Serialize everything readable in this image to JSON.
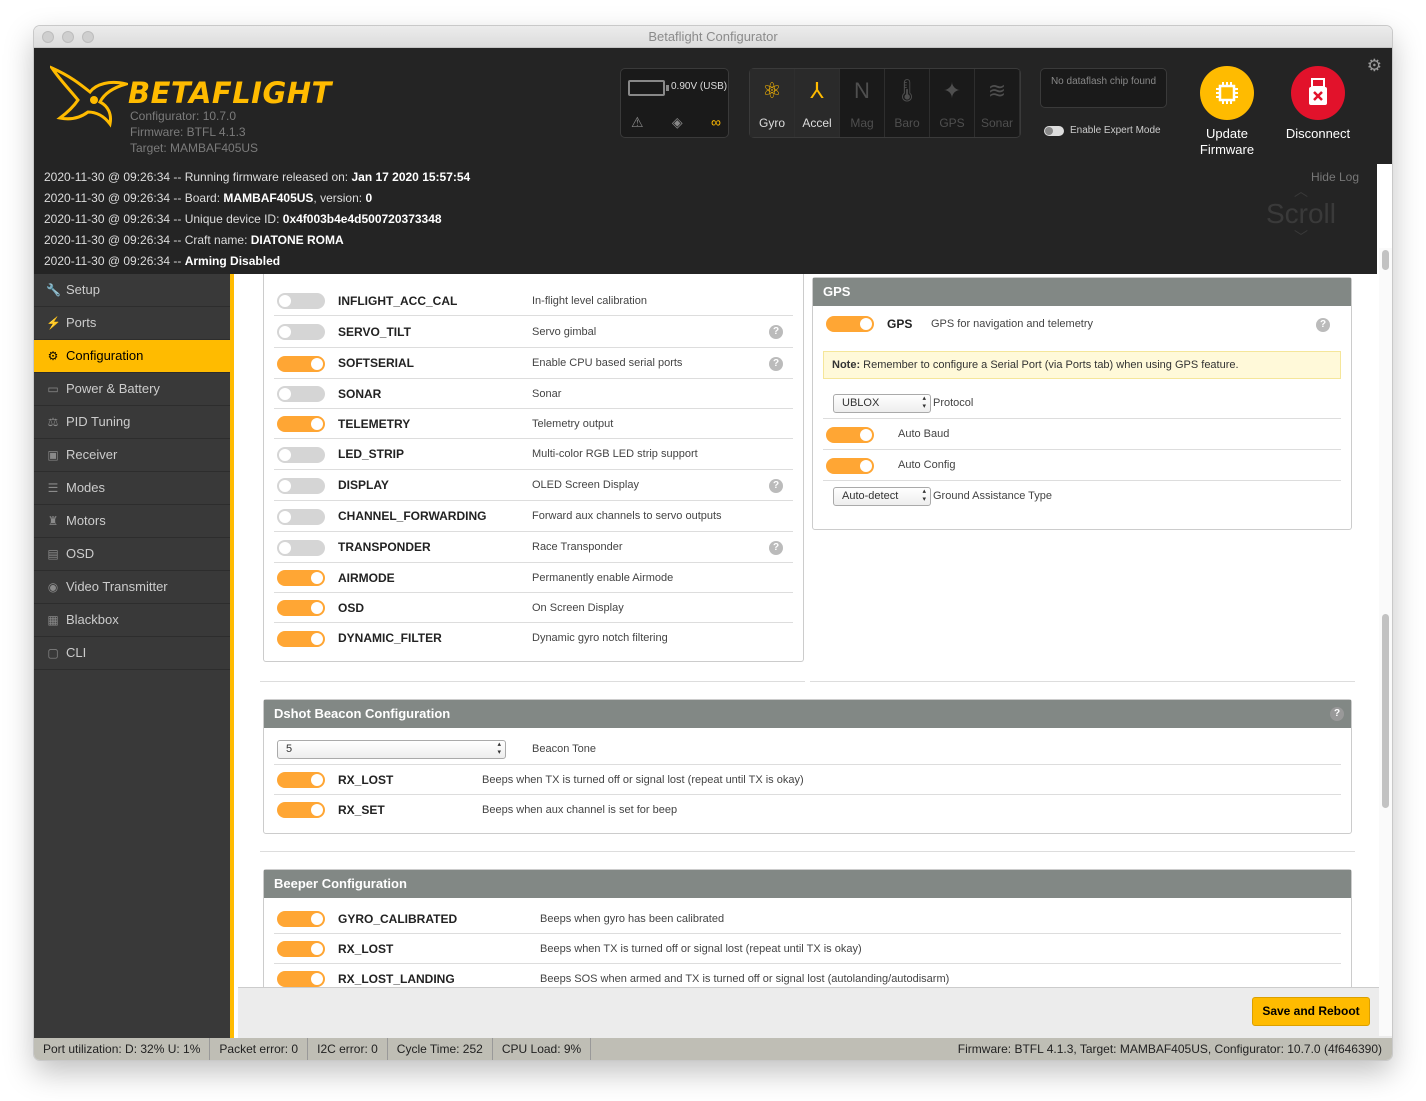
{
  "window": {
    "title": "Betaflight Configurator"
  },
  "header": {
    "brand": "BETAFLIGHT",
    "configurator": "Configurator: 10.7.0",
    "firmware": "Firmware: BTFL 4.1.3",
    "target": "Target: MAMBAF405US",
    "battery": "0.90V (USB)",
    "sensors": [
      {
        "label": "Gyro",
        "active": true,
        "icon": "gyro-icon"
      },
      {
        "label": "Accel",
        "active": true,
        "icon": "accel-icon"
      },
      {
        "label": "Mag",
        "active": false,
        "icon": "mag-icon"
      },
      {
        "label": "Baro",
        "active": false,
        "icon": "baro-icon"
      },
      {
        "label": "GPS",
        "active": false,
        "icon": "gps-icon"
      },
      {
        "label": "Sonar",
        "active": false,
        "icon": "sonar-icon"
      }
    ],
    "dataflash": "No dataflash chip found",
    "expert_mode": "Enable Expert Mode",
    "update_firmware": "Update Firmware",
    "disconnect": "Disconnect"
  },
  "log": {
    "hide": "Hide Log",
    "scroll": "Scroll",
    "lines": [
      {
        "prefix": "2020-11-30 @ 09:26:34 -- Running firmware released on: ",
        "value": "Jan 17 2020 15:57:54",
        "suffix": ""
      },
      {
        "prefix": "2020-11-30 @ 09:26:34 -- Board: ",
        "value": "MAMBAF405US",
        "suffix": ", version: ",
        "value2": "0"
      },
      {
        "prefix": "2020-11-30 @ 09:26:34 -- Unique device ID: ",
        "value": "0x4f003b4e4d500720373348",
        "suffix": ""
      },
      {
        "prefix": "2020-11-30 @ 09:26:34 -- Craft name: ",
        "value": "DIATONE ROMA",
        "suffix": ""
      },
      {
        "prefix": "2020-11-30 @ 09:26:34 -- ",
        "value": "Arming Disabled",
        "suffix": ""
      }
    ]
  },
  "sidebar": {
    "items": [
      {
        "label": "Setup",
        "icon": "wrench-icon",
        "active": false
      },
      {
        "label": "Ports",
        "icon": "plug-icon",
        "active": false
      },
      {
        "label": "Configuration",
        "icon": "gear-icon",
        "active": true
      },
      {
        "label": "Power & Battery",
        "icon": "battery-icon",
        "active": false
      },
      {
        "label": "PID Tuning",
        "icon": "pid-icon",
        "active": false
      },
      {
        "label": "Receiver",
        "icon": "receiver-icon",
        "active": false
      },
      {
        "label": "Modes",
        "icon": "modes-icon",
        "active": false
      },
      {
        "label": "Motors",
        "icon": "motor-icon",
        "active": false
      },
      {
        "label": "OSD",
        "icon": "osd-icon",
        "active": false
      },
      {
        "label": "Video Transmitter",
        "icon": "vtx-icon",
        "active": false
      },
      {
        "label": "Blackbox",
        "icon": "blackbox-icon",
        "active": false
      },
      {
        "label": "CLI",
        "icon": "cli-icon",
        "active": false
      }
    ]
  },
  "features": [
    {
      "name": "INFLIGHT_ACC_CAL",
      "desc": "In-flight level calibration",
      "on": false,
      "help": false
    },
    {
      "name": "SERVO_TILT",
      "desc": "Servo gimbal",
      "on": false,
      "help": true
    },
    {
      "name": "SOFTSERIAL",
      "desc": "Enable CPU based serial ports",
      "on": true,
      "help": true
    },
    {
      "name": "SONAR",
      "desc": "Sonar",
      "on": false,
      "help": false
    },
    {
      "name": "TELEMETRY",
      "desc": "Telemetry output",
      "on": true,
      "help": false
    },
    {
      "name": "LED_STRIP",
      "desc": "Multi-color RGB LED strip support",
      "on": false,
      "help": false
    },
    {
      "name": "DISPLAY",
      "desc": "OLED Screen Display",
      "on": false,
      "help": true
    },
    {
      "name": "CHANNEL_FORWARDING",
      "desc": "Forward aux channels to servo outputs",
      "on": false,
      "help": false
    },
    {
      "name": "TRANSPONDER",
      "desc": "Race Transponder",
      "on": false,
      "help": true
    },
    {
      "name": "AIRMODE",
      "desc": "Permanently enable Airmode",
      "on": true,
      "help": false
    },
    {
      "name": "OSD",
      "desc": "On Screen Display",
      "on": true,
      "help": false
    },
    {
      "name": "DYNAMIC_FILTER",
      "desc": "Dynamic gyro notch filtering",
      "on": true,
      "help": false
    }
  ],
  "gps": {
    "title": "GPS",
    "feature_name": "GPS",
    "feature_desc": "GPS for navigation and telemetry",
    "note_bold": "Note:",
    "note_text": " Remember to configure a Serial Port (via Ports tab) when using GPS feature.",
    "protocol_value": "UBLOX",
    "protocol_label": "Protocol",
    "auto_baud": "Auto Baud",
    "auto_config": "Auto Config",
    "ground_value": "Auto-detect",
    "ground_label": "Ground Assistance Type"
  },
  "dshot": {
    "title": "Dshot Beacon Configuration",
    "tone_value": "5",
    "tone_label": "Beacon Tone",
    "items": [
      {
        "name": "RX_LOST",
        "desc": "Beeps when TX is turned off or signal lost (repeat until TX is okay)",
        "on": true
      },
      {
        "name": "RX_SET",
        "desc": "Beeps when aux channel is set for beep",
        "on": true
      }
    ]
  },
  "beeper": {
    "title": "Beeper Configuration",
    "items": [
      {
        "name": "GYRO_CALIBRATED",
        "desc": "Beeps when gyro has been calibrated",
        "on": true
      },
      {
        "name": "RX_LOST",
        "desc": "Beeps when TX is turned off or signal lost (repeat until TX is okay)",
        "on": true
      },
      {
        "name": "RX_LOST_LANDING",
        "desc": "Beeps SOS when armed and TX is turned off or signal lost (autolanding/autodisarm)",
        "on": true
      }
    ]
  },
  "footer": {
    "save": "Save and Reboot"
  },
  "status": {
    "port": "Port utilization: D: 32% U: 1%",
    "packet": "Packet error: 0",
    "i2c": "I2C error: 0",
    "cycle": "Cycle Time: 252",
    "cpu": "CPU Load: 9%",
    "right": "Firmware: BTFL 4.1.3, Target: MAMBAF405US, Configurator: 10.7.0 (4f646390)"
  }
}
